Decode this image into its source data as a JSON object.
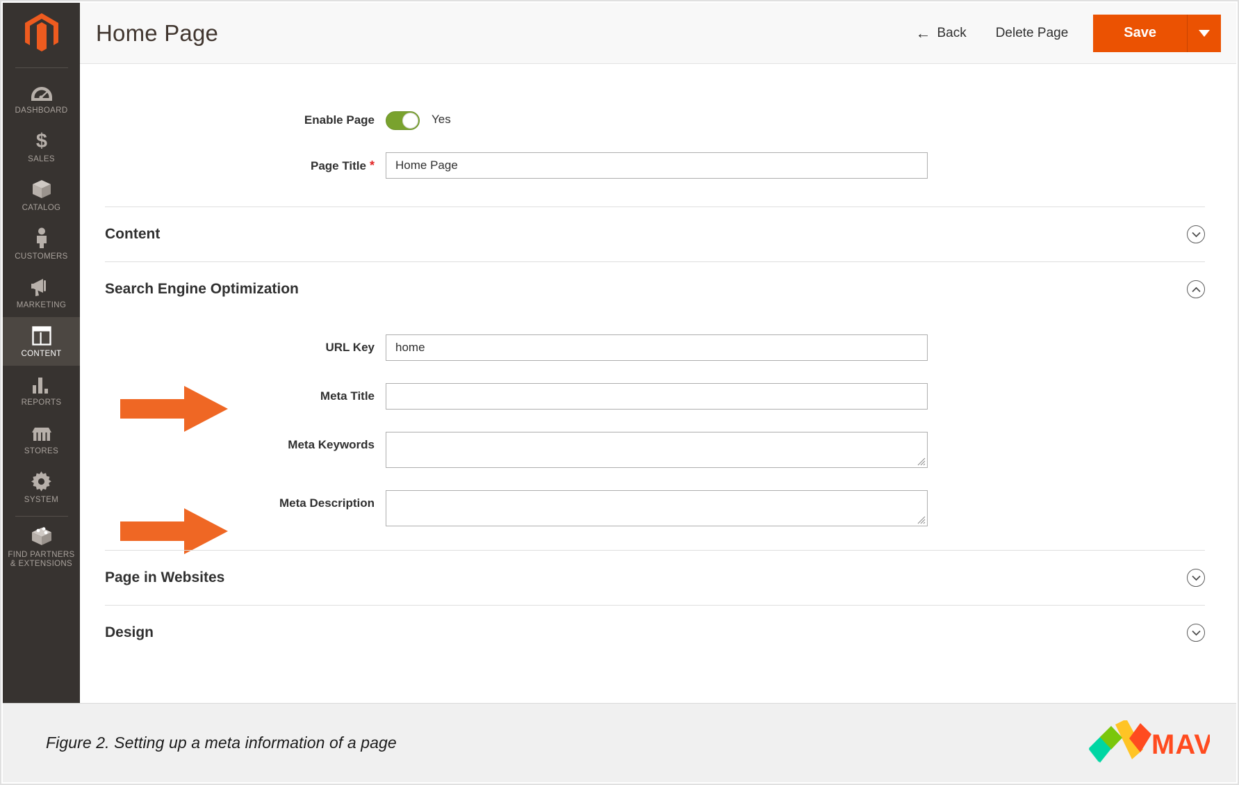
{
  "app": {
    "brand_logo": "magento-logo-icon",
    "accent_color": "#eb5202",
    "sidebar_bg": "#373330",
    "toggle_on_color": "#79a22e",
    "required_marker_color": "#e22626"
  },
  "sidebar": {
    "items": [
      {
        "label": "DASHBOARD",
        "icon": "dashboard-gauge-icon",
        "active": false
      },
      {
        "label": "SALES",
        "icon": "dollar-sign-icon",
        "active": false
      },
      {
        "label": "CATALOG",
        "icon": "box-icon",
        "active": false
      },
      {
        "label": "CUSTOMERS",
        "icon": "person-icon",
        "active": false
      },
      {
        "label": "MARKETING",
        "icon": "megaphone-icon",
        "active": false
      },
      {
        "label": "CONTENT",
        "icon": "layout-panel-icon",
        "active": true
      },
      {
        "label": "REPORTS",
        "icon": "bar-chart-icon",
        "active": false
      },
      {
        "label": "STORES",
        "icon": "storefront-icon",
        "active": false
      },
      {
        "label": "SYSTEM",
        "icon": "gear-icon",
        "active": false
      },
      {
        "label": "FIND PARTNERS\n& EXTENSIONS",
        "label_line1": "FIND PARTNERS",
        "label_line2": "& EXTENSIONS",
        "icon": "extension-blocks-icon",
        "active": false
      }
    ]
  },
  "header": {
    "title": "Home Page",
    "back_label": "Back",
    "back_icon": "arrow-left-icon",
    "delete_label": "Delete Page",
    "save_label": "Save",
    "save_caret_icon": "caret-down-icon"
  },
  "form": {
    "enable_page": {
      "label": "Enable Page",
      "value": "Yes",
      "state": "on"
    },
    "page_title": {
      "label": "Page Title",
      "required": "*",
      "value": "Home Page",
      "placeholder": ""
    }
  },
  "sections": [
    {
      "title": "Content",
      "expanded": false,
      "chevron": "chevron-down-icon"
    },
    {
      "title": "Search Engine Optimization",
      "expanded": true,
      "chevron": "chevron-up-icon"
    },
    {
      "title": "Page in Websites",
      "expanded": false,
      "chevron": "chevron-down-icon"
    },
    {
      "title": "Design",
      "expanded": false,
      "chevron": "chevron-down-icon"
    }
  ],
  "seo": {
    "url_key": {
      "label": "URL Key",
      "value": "home",
      "placeholder": ""
    },
    "meta_title": {
      "label": "Meta Title",
      "value": "",
      "placeholder": ""
    },
    "meta_keywords": {
      "label": "Meta Keywords",
      "value": "",
      "placeholder": ""
    },
    "meta_description": {
      "label": "Meta Description",
      "value": "",
      "placeholder": ""
    }
  },
  "annotations": [
    {
      "name": "arrow-pointing-to-meta-title",
      "color": "#ef6724"
    },
    {
      "name": "arrow-pointing-to-meta-description",
      "color": "#ef6724"
    }
  ],
  "footer": {
    "caption": "Figure 2. Setting up a meta information of a page",
    "logo_text": "MAVEN",
    "logo_mark": "maven-diamond-m-icon",
    "logo_colors": [
      "#00d6a3",
      "#1a9ff0",
      "#7ac70c",
      "#ffc425",
      "#ff4b1f"
    ]
  }
}
